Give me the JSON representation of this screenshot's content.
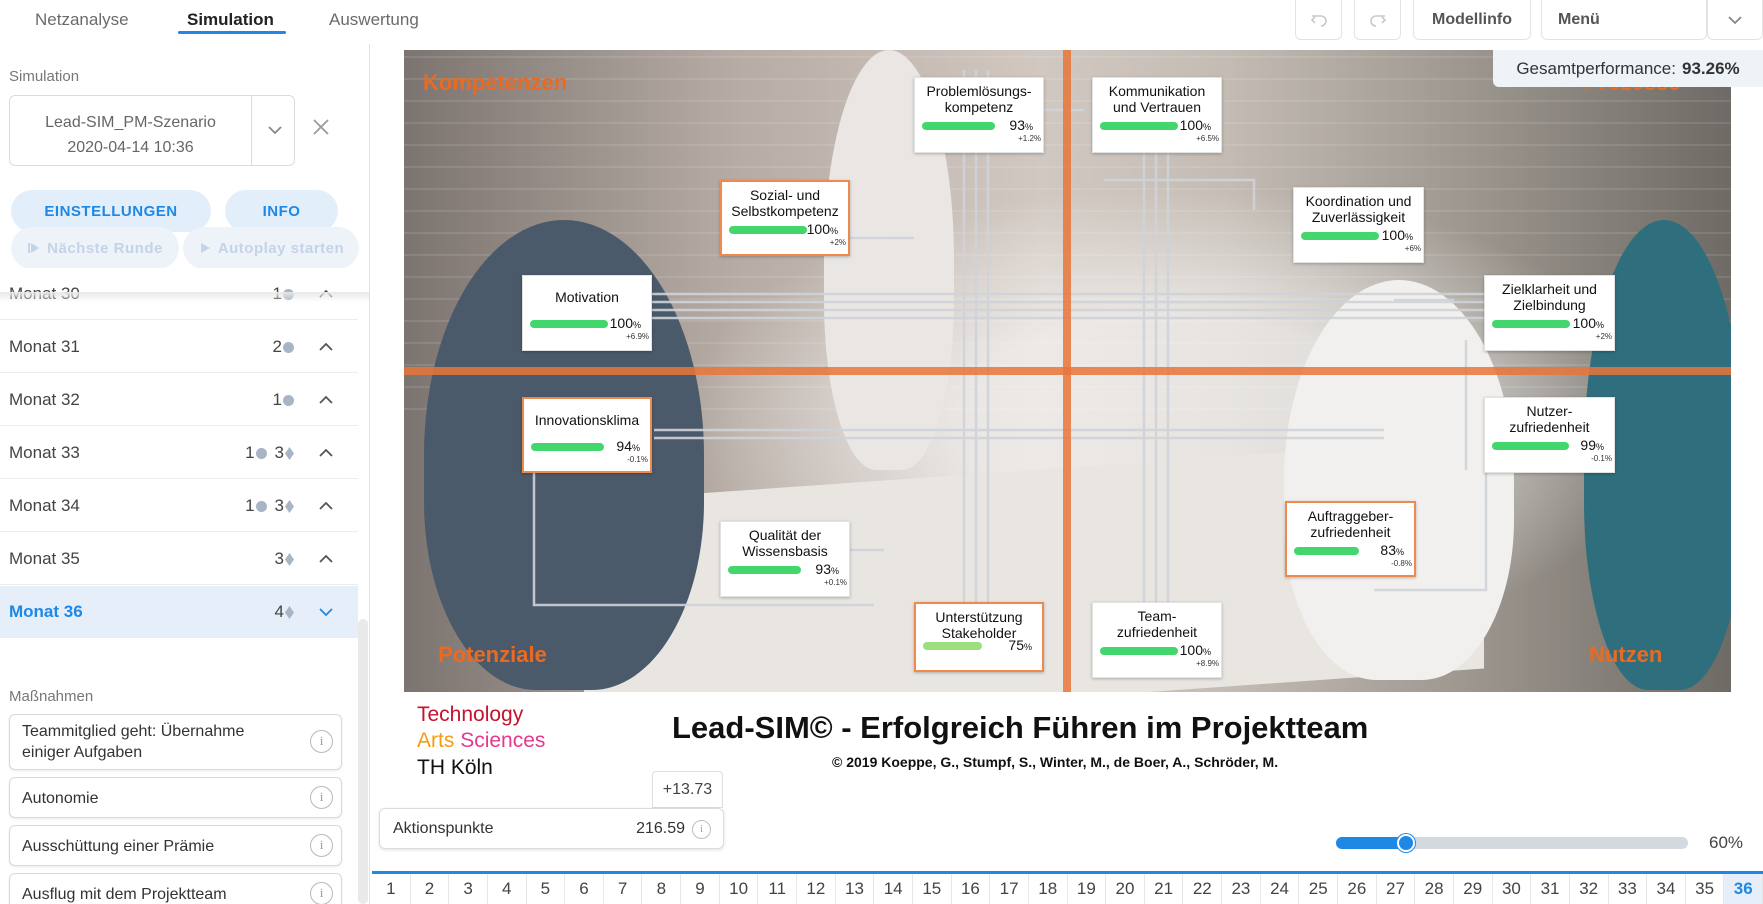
{
  "tabs": [
    {
      "label": "Netzanalyse"
    },
    {
      "label": "Simulation"
    },
    {
      "label": "Auswertung"
    }
  ],
  "toolbar": {
    "undo_icon": "undo-icon",
    "redo_icon": "redo-icon",
    "modelinfo_label": "Modellinfo",
    "menu_label": "Menü"
  },
  "sidebar": {
    "title": "Simulation",
    "scenario_line1": "Lead-SIM_PM-Szenario",
    "scenario_line2": "2020-04-14 10:36",
    "settings_label": "EINSTELLUNGEN",
    "info_label": "INFO",
    "next_round_label": "Nächste Runde",
    "autoplay_label": "Autoplay starten",
    "months": [
      {
        "label": "Monat 30",
        "dots": "1",
        "diamonds": ""
      },
      {
        "label": "Monat 31",
        "dots": "2",
        "diamonds": ""
      },
      {
        "label": "Monat 32",
        "dots": "1",
        "diamonds": ""
      },
      {
        "label": "Monat 33",
        "dots": "1",
        "diamonds": "3"
      },
      {
        "label": "Monat 34",
        "dots": "1",
        "diamonds": "3"
      },
      {
        "label": "Monat 35",
        "dots": "",
        "diamonds": "3"
      },
      {
        "label": "Monat 36",
        "dots": "",
        "diamonds": "4"
      }
    ],
    "measures_title": "Maßnahmen",
    "measures": [
      {
        "label": "Teammitglied geht: Übernahme einiger Aufgaben"
      },
      {
        "label": "Autonomie"
      },
      {
        "label": "Ausschüttung einer Prämie"
      },
      {
        "label": "Ausflug mit dem Projektteam"
      }
    ]
  },
  "performance": {
    "label": "Gesamtperformance:",
    "value": "93.26%"
  },
  "quadrants": {
    "top_left": "Kompetenzen",
    "top_right": "Prozesse",
    "bottom_left": "Potenziale",
    "bottom_right": "Nutzen"
  },
  "nodes": [
    {
      "title": "Problemlösungs-\nkompetenz",
      "value": "93",
      "unit": "%",
      "delta": "+1.2%",
      "fill": 0.93
    },
    {
      "title": "Kommunikation\nund Vertrauen",
      "value": "100",
      "unit": "%",
      "delta": "+6.5%",
      "fill": 1.0
    },
    {
      "title": "Sozial- und\nSelbstkompetenz",
      "value": "100",
      "unit": "%",
      "delta": "+2%",
      "fill": 1.0
    },
    {
      "title": "Koordination und\nZuverlässigkeit",
      "value": "100",
      "unit": "%",
      "delta": "+6%",
      "fill": 1.0
    },
    {
      "title": "Motivation",
      "value": "100",
      "unit": "%",
      "delta": "+6.9%",
      "fill": 1.0
    },
    {
      "title": "Zielklarheit und\nZielbindung",
      "value": "100",
      "unit": "%",
      "delta": "+2%",
      "fill": 1.0
    },
    {
      "title": "Innovationsklima",
      "value": "94",
      "unit": "%",
      "delta": "-0.1%",
      "fill": 0.94
    },
    {
      "title": "Nutzer-\nzufriedenheit",
      "value": "99",
      "unit": "%",
      "delta": "-0.1%",
      "fill": 0.99
    },
    {
      "title": "Qualität der\nWissensbasis",
      "value": "93",
      "unit": "%",
      "delta": "+0.1%",
      "fill": 0.93
    },
    {
      "title": "Auftraggeber-\nzufriedenheit",
      "value": "83",
      "unit": "%",
      "delta": "-0.8%",
      "fill": 0.83
    },
    {
      "title": "Unterstützung\nStakeholder",
      "value": "75",
      "unit": "%",
      "delta": "",
      "fill": 0.75
    },
    {
      "title": "Team-\nzufriedenheit",
      "value": "100",
      "unit": "%",
      "delta": "+8.9%",
      "fill": 1.0
    }
  ],
  "logo": {
    "line1": "Technology",
    "line2a": "Arts",
    "line2b": "Sciences",
    "line3": "TH Köln"
  },
  "title": "Lead-SIM© - Erfolgreich Führen im Projektteam",
  "copyright": "© 2019 Koeppe, G., Stumpf, S., Winter, M., de Boer, A., Schröder, M.",
  "action_points": {
    "delta": "+13.73",
    "label": "Aktionspunkte",
    "value": "216.59"
  },
  "zoom": {
    "value": "60%",
    "level": 0.2
  },
  "timeline": {
    "months": [
      "1",
      "2",
      "3",
      "4",
      "5",
      "6",
      "7",
      "8",
      "9",
      "10",
      "11",
      "12",
      "13",
      "14",
      "15",
      "16",
      "17",
      "18",
      "19",
      "20",
      "21",
      "22",
      "23",
      "24",
      "25",
      "26",
      "27",
      "28",
      "29",
      "30",
      "31",
      "32",
      "33",
      "34",
      "35",
      "36"
    ],
    "active": "36"
  },
  "colors": {
    "accent": "#1e88e5",
    "orange": "#e8763a",
    "bar": "#43d66d"
  }
}
